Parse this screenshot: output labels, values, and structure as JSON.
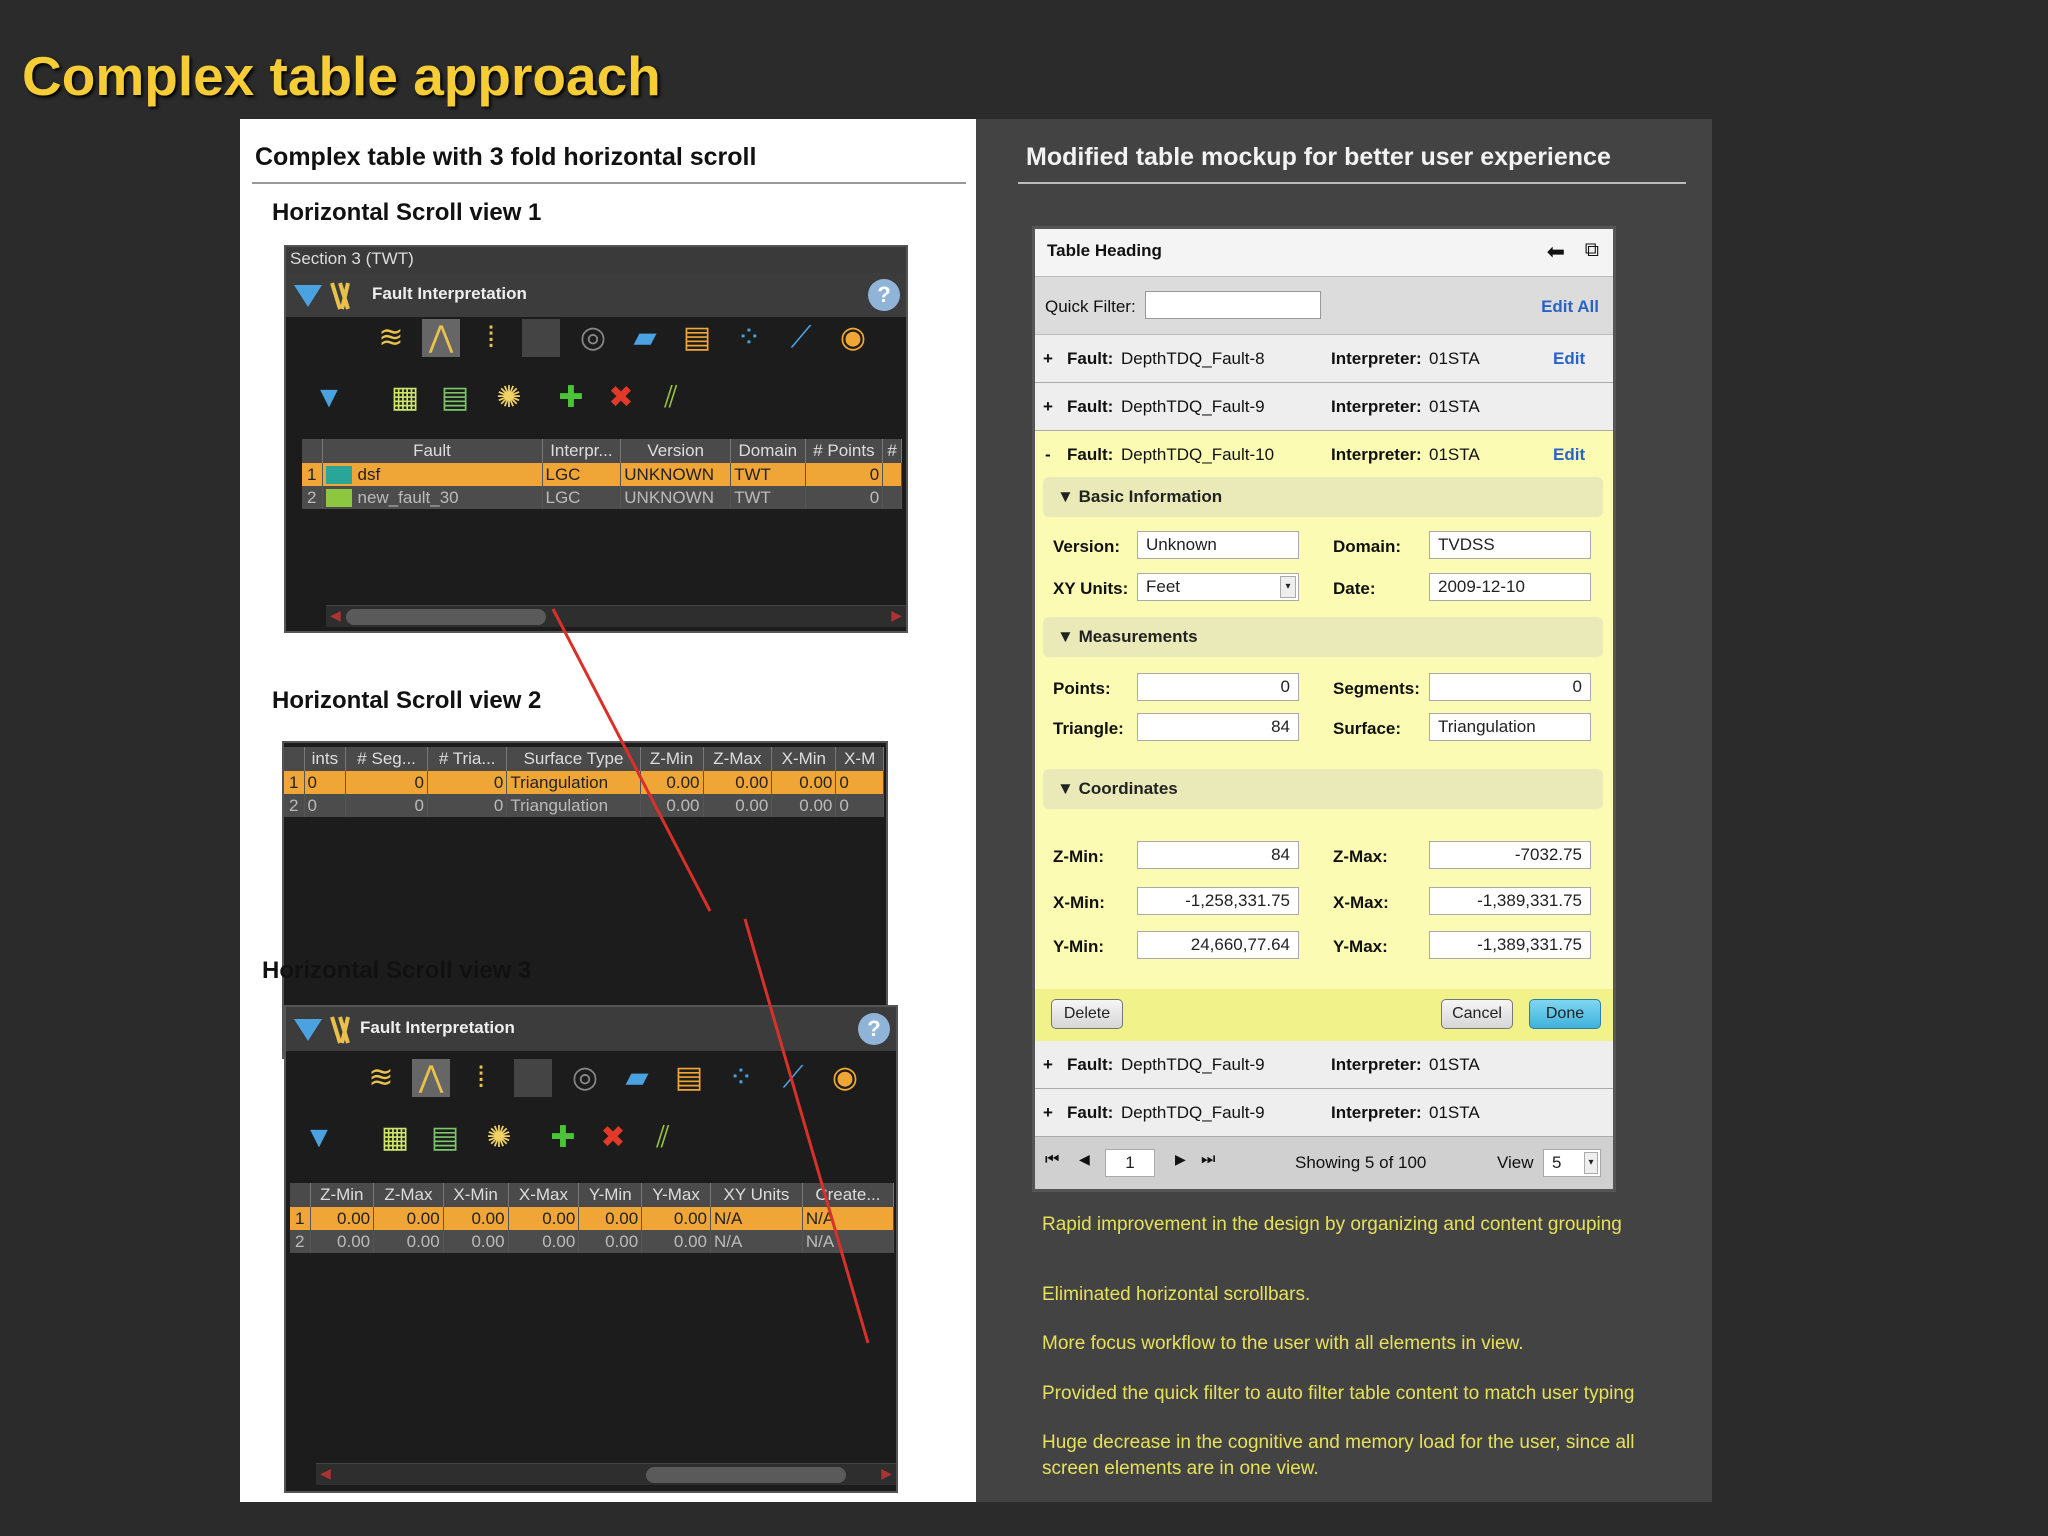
{
  "title": "Complex table approach",
  "left": {
    "heading": "Complex table with 3 fold horizontal scroll",
    "view1": {
      "label": "Horizontal Scroll view 1",
      "caption": "Section 3 (TWT)",
      "window_title": "Fault Interpretation",
      "help": "?",
      "columns": [
        "",
        "Fault",
        "Interpr...",
        "Version",
        "Domain",
        "# Points",
        "#"
      ],
      "rows": [
        [
          "1",
          "dsf",
          "LGC",
          "UNKNOWN",
          "TWT",
          "0"
        ],
        [
          "2",
          "new_fault_30",
          "LGC",
          "UNKNOWN",
          "TWT",
          "0"
        ]
      ]
    },
    "view2": {
      "label": "Horizontal Scroll view 2",
      "columns": [
        "",
        "ints",
        "# Seg...",
        "# Tria...",
        "Surface Type",
        "Z-Min",
        "Z-Max",
        "X-Min",
        "X-M"
      ],
      "rows": [
        [
          "1",
          "0",
          "0",
          "0",
          "Triangulation",
          "0.00",
          "0.00",
          "0.00",
          "0"
        ],
        [
          "2",
          "0",
          "0",
          "0",
          "Triangulation",
          "0.00",
          "0.00",
          "0.00",
          "0"
        ]
      ]
    },
    "view3": {
      "label": "Horizontal Scroll view 3",
      "window_title": "Fault Interpretation",
      "help": "?",
      "columns": [
        "",
        "Z-Min",
        "Z-Max",
        "X-Min",
        "X-Max",
        "Y-Min",
        "Y-Max",
        "XY Units",
        "Create..."
      ],
      "rows": [
        [
          "1",
          "0.00",
          "0.00",
          "0.00",
          "0.00",
          "0.00",
          "0.00",
          "N/A",
          "N/A"
        ],
        [
          "2",
          "0.00",
          "0.00",
          "0.00",
          "0.00",
          "0.00",
          "0.00",
          "N/A",
          "N/A"
        ]
      ]
    },
    "colors": {
      "selection": "#f0a636",
      "connector": "#d9302a"
    }
  },
  "right": {
    "heading": "Modified table  mockup for better user experience",
    "mockup": {
      "table_heading": "Table Heading",
      "quick_filter_label": "Quick Filter:",
      "quick_filter_value": "",
      "edit_all": "Edit All",
      "edit": "Edit",
      "fault_label": "Fault:",
      "interpreter_label": "Interpreter:",
      "rows_top": [
        {
          "toggle": "+",
          "fault": "DepthTDQ_Fault-8",
          "interpreter": "01STA",
          "edit": true
        },
        {
          "toggle": "+",
          "fault": "DepthTDQ_Fault-9",
          "interpreter": "01STA",
          "edit": false
        }
      ],
      "expanded": {
        "toggle": "-",
        "fault": "DepthTDQ_Fault-10",
        "interpreter": "01STA"
      },
      "basic": {
        "title": "Basic Information",
        "version_label": "Version:",
        "version": "Unknown",
        "domain_label": "Domain:",
        "domain": "TVDSS",
        "xyunits_label": "XY Units:",
        "xyunits": "Feet",
        "date_label": "Date:",
        "date": "2009-12-10"
      },
      "measurements": {
        "title": "Measurements",
        "points_label": "Points:",
        "points": "0",
        "segments_label": "Segments:",
        "segments": "0",
        "triangle_label": "Triangle:",
        "triangle": "84",
        "surface_label": "Surface:",
        "surface": "Triangulation"
      },
      "coordinates": {
        "title": "Coordinates",
        "zmin_label": "Z-Min:",
        "zmin": "84",
        "zmax_label": "Z-Max:",
        "zmax": "-7032.75",
        "xmin_label": "X-Min:",
        "xmin": "-1,258,331.75",
        "xmax_label": "X-Max:",
        "xmax": "-1,389,331.75",
        "ymin_label": "Y-Min:",
        "ymin": "24,660,77.64",
        "ymax_label": "Y-Max:",
        "ymax": "-1,389,331.75"
      },
      "buttons": {
        "delete": "Delete",
        "cancel": "Cancel",
        "done": "Done"
      },
      "rows_bottom": [
        {
          "toggle": "+",
          "fault": "DepthTDQ_Fault-9",
          "interpreter": "01STA"
        },
        {
          "toggle": "+",
          "fault": "DepthTDQ_Fault-9",
          "interpreter": "01STA"
        }
      ],
      "pager": {
        "page": "1",
        "showing": "Showing 5 of 100",
        "view_label": "View",
        "view_value": "5"
      }
    },
    "notes": [
      "Rapid improvement in the design by organizing and content grouping",
      "Eliminated horizontal scrollbars.",
      "More focus workflow to the user with all elements in view.",
      "Provided the quick filter to auto filter table content to match user typing",
      "Huge decrease in the cognitive and memory load for the user, since all screen elements are in one view."
    ]
  }
}
